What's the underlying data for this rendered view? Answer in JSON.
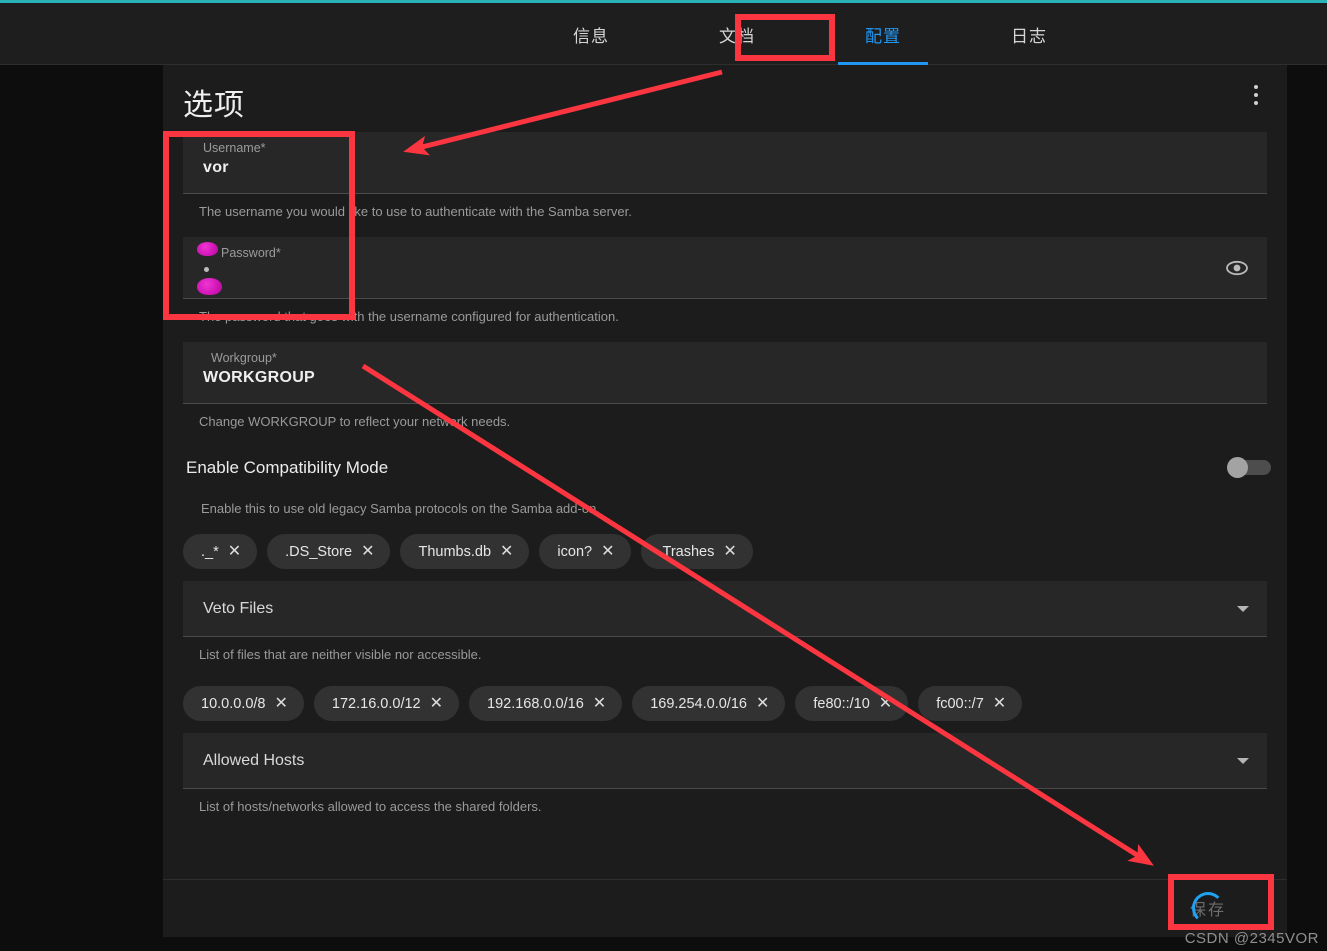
{
  "theme": {
    "accent_top": "#2bb2b6",
    "tab_active": "#2196f3",
    "annotation_red": "#fb3640",
    "page_bg": "#0d0d0d",
    "card_bg": "#1c1c1c",
    "field_bg": "#272727",
    "redaction_pink": "#d914bb",
    "spinner_blue": "#1fa2f0"
  },
  "tabs": [
    {
      "label": "信息",
      "active": false
    },
    {
      "label": "文档",
      "active": false
    },
    {
      "label": "配置",
      "active": true
    },
    {
      "label": "日志",
      "active": false
    }
  ],
  "card": {
    "title": "选项",
    "menu_icon": "kebab-menu-icon"
  },
  "fields": {
    "username": {
      "label": "Username*",
      "value": "vor",
      "hint": "The username you would like to use to authenticate with the Samba server."
    },
    "password": {
      "label": "Password*",
      "value": "•",
      "hint": "The password that goes with the username configured for authentication.",
      "reveal_icon": "eye-icon",
      "redacted": true
    },
    "workgroup": {
      "label": "Workgroup*",
      "value": "WORKGROUP",
      "hint": "Change WORKGROUP to reflect your network needs."
    }
  },
  "compatibility": {
    "title": "Enable Compatibility Mode",
    "hint": "Enable this to use old legacy Samba protocols on the Samba add-on.",
    "enabled": false
  },
  "veto_files": {
    "select_label": "Veto Files",
    "hint": "List of files that are neither visible nor accessible.",
    "chips": [
      "._*",
      ".DS_Store",
      "Thumbs.db",
      "icon?",
      ".Trashes"
    ]
  },
  "allowed_hosts": {
    "select_label": "Allowed Hosts",
    "hint": "List of hosts/networks allowed to access the shared folders.",
    "chips": [
      "10.0.0.0/8",
      "172.16.0.0/12",
      "192.168.0.0/16",
      "169.254.0.0/16",
      "fe80::/10",
      "fc00::/7"
    ]
  },
  "footer": {
    "save_label": "保存",
    "saving": true
  },
  "watermark": "CSDN @2345VOR",
  "chip_remove_glyph": "✕"
}
